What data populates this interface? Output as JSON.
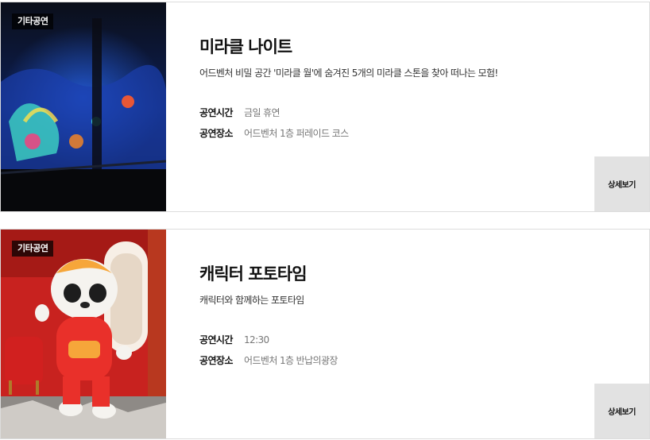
{
  "events": [
    {
      "badge": "기타공연",
      "title": "미라클 나이트",
      "description": "어드벤처 비밀 공간 '미라클 월'에 숨겨진 5개의 미라클 스톤을 찾아 떠나는 모험!",
      "time_label": "공연시간",
      "time_value": "금일 휴연",
      "place_label": "공연장소",
      "place_value": "어드벤처 1층 퍼레이드 코스",
      "detail_label": "상세보기"
    },
    {
      "badge": "기타공연",
      "title": "캐릭터 포토타임",
      "description": "캐릭터와 함께하는 포토타임",
      "time_label": "공연시간",
      "time_value": "12:30",
      "place_label": "공연장소",
      "place_value": "어드벤처 1층 반납의광장",
      "detail_label": "상세보기"
    }
  ]
}
